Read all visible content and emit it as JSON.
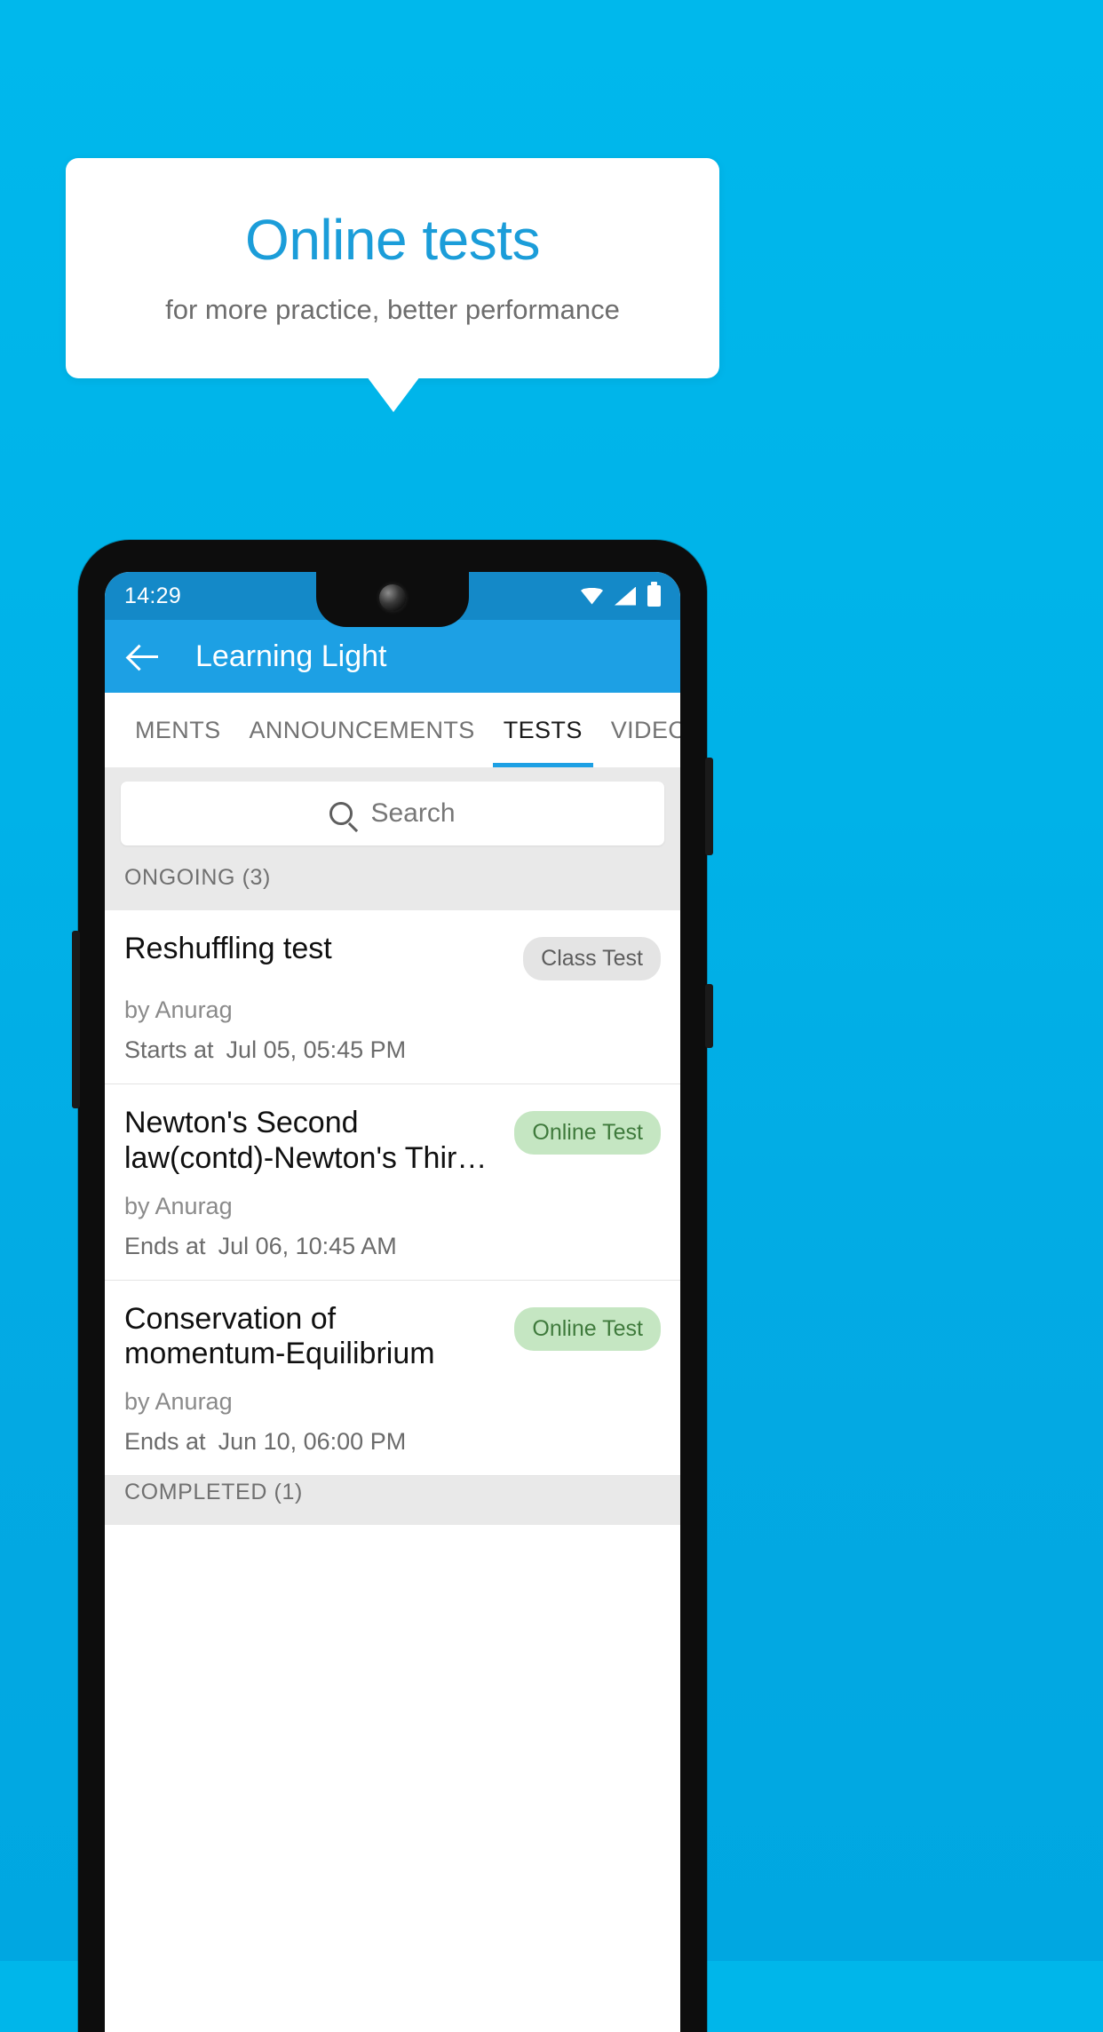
{
  "promo": {
    "title": "Online tests",
    "subtitle": "for more practice, better performance",
    "accent_color": "#1b9dd9",
    "background_color": "#00b2e8"
  },
  "phone": {
    "status_bar": {
      "time": "14:29",
      "icons": [
        "wifi-icon",
        "signal-icon",
        "battery-icon"
      ]
    },
    "app_bar": {
      "back_icon": "back-arrow-icon",
      "title": "Learning Light",
      "color": "#1da0e4"
    },
    "tabs": [
      {
        "label": "MENTS",
        "active": false
      },
      {
        "label": "ANNOUNCEMENTS",
        "active": false
      },
      {
        "label": "TESTS",
        "active": true
      },
      {
        "label": "VIDEOS",
        "active": false
      }
    ],
    "search": {
      "icon": "search-icon",
      "placeholder": "Search",
      "value": ""
    },
    "sections": [
      {
        "header": "ONGOING (3)",
        "items": [
          {
            "title": "Reshuffling test",
            "badge": "Class Test",
            "badge_type": "class",
            "author": "by Anurag",
            "time_label": "Starts at",
            "time_value": "Jul 05, 05:45 PM"
          },
          {
            "title": "Newton's Second law(contd)-Newton's Thir…",
            "badge": "Online Test",
            "badge_type": "online",
            "author": "by Anurag",
            "time_label": "Ends at",
            "time_value": "Jul 06, 10:45 AM"
          },
          {
            "title": "Conservation of momentum-Equilibrium",
            "badge": "Online Test",
            "badge_type": "online",
            "author": "by Anurag",
            "time_label": "Ends at",
            "time_value": "Jun 10, 06:00 PM"
          }
        ]
      },
      {
        "header": "COMPLETED (1)",
        "items": []
      }
    ]
  }
}
